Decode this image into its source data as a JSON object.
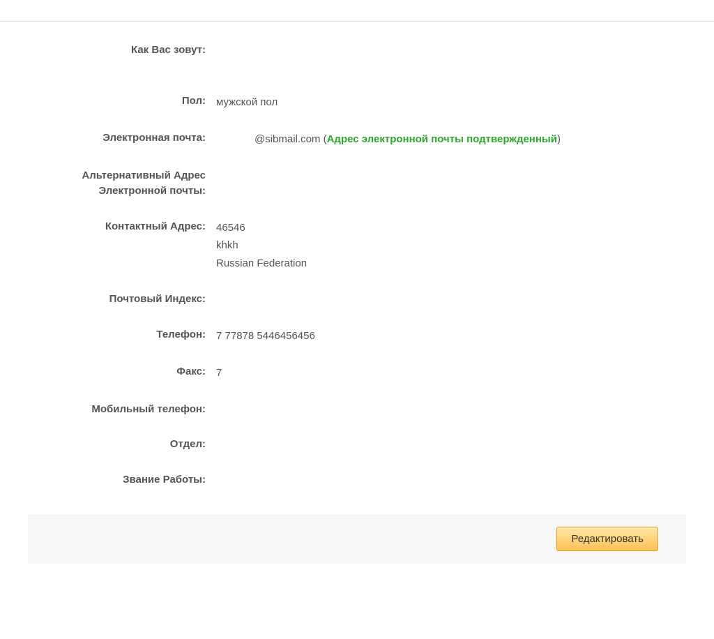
{
  "profile": {
    "name_label": "Как Вас зовут:",
    "name_value": "",
    "gender_label": "Пол:",
    "gender_value": "мужской пол",
    "email_label": "Электронная почта:",
    "email_value": "@sibmail.com",
    "email_paren_open": " (",
    "email_verified": "Адрес электронной почты подтвержденный",
    "email_paren_close": ")",
    "alt_email_label_line1": "Альтернативный Адрес",
    "alt_email_label_line2": "Электронной почты:",
    "alt_email_value": "",
    "address_label": "Контактный Адрес:",
    "address_line1": "46546",
    "address_line2": "khkh",
    "address_line3": "Russian Federation",
    "postal_label": "Почтовый Индекс:",
    "postal_value": "",
    "phone_label": "Телефон:",
    "phone_value": "7 77878 5446456456",
    "fax_label": "Факс:",
    "fax_value": "7",
    "mobile_label": "Мобильный телефон:",
    "mobile_value": "",
    "department_label": "Отдел:",
    "department_value": "",
    "job_title_label": "Звание Работы:",
    "job_title_value": ""
  },
  "actions": {
    "edit_label": "Редактировать"
  }
}
